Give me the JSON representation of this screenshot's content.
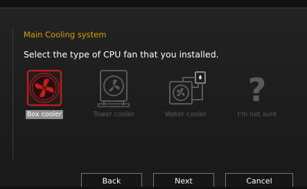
{
  "section_title": "Main Cooling system",
  "prompt": "Select the type of CPU fan that you installed.",
  "options": [
    {
      "label": "Box cooler",
      "icon": "box-cooler-icon",
      "selected": true
    },
    {
      "label": "Tower cooler",
      "icon": "tower-cooler-icon",
      "selected": false
    },
    {
      "label": "Water cooler",
      "icon": "water-cooler-icon",
      "selected": false
    },
    {
      "label": "I'm not sure",
      "icon": "question-mark-icon",
      "selected": false
    }
  ],
  "buttons": {
    "back": "Back",
    "next": "Next",
    "cancel": "Cancel"
  },
  "colors": {
    "accent_title": "#d9a400",
    "selected_icon": "#b81d1d",
    "unselected_icon": "#5a5a5a"
  }
}
